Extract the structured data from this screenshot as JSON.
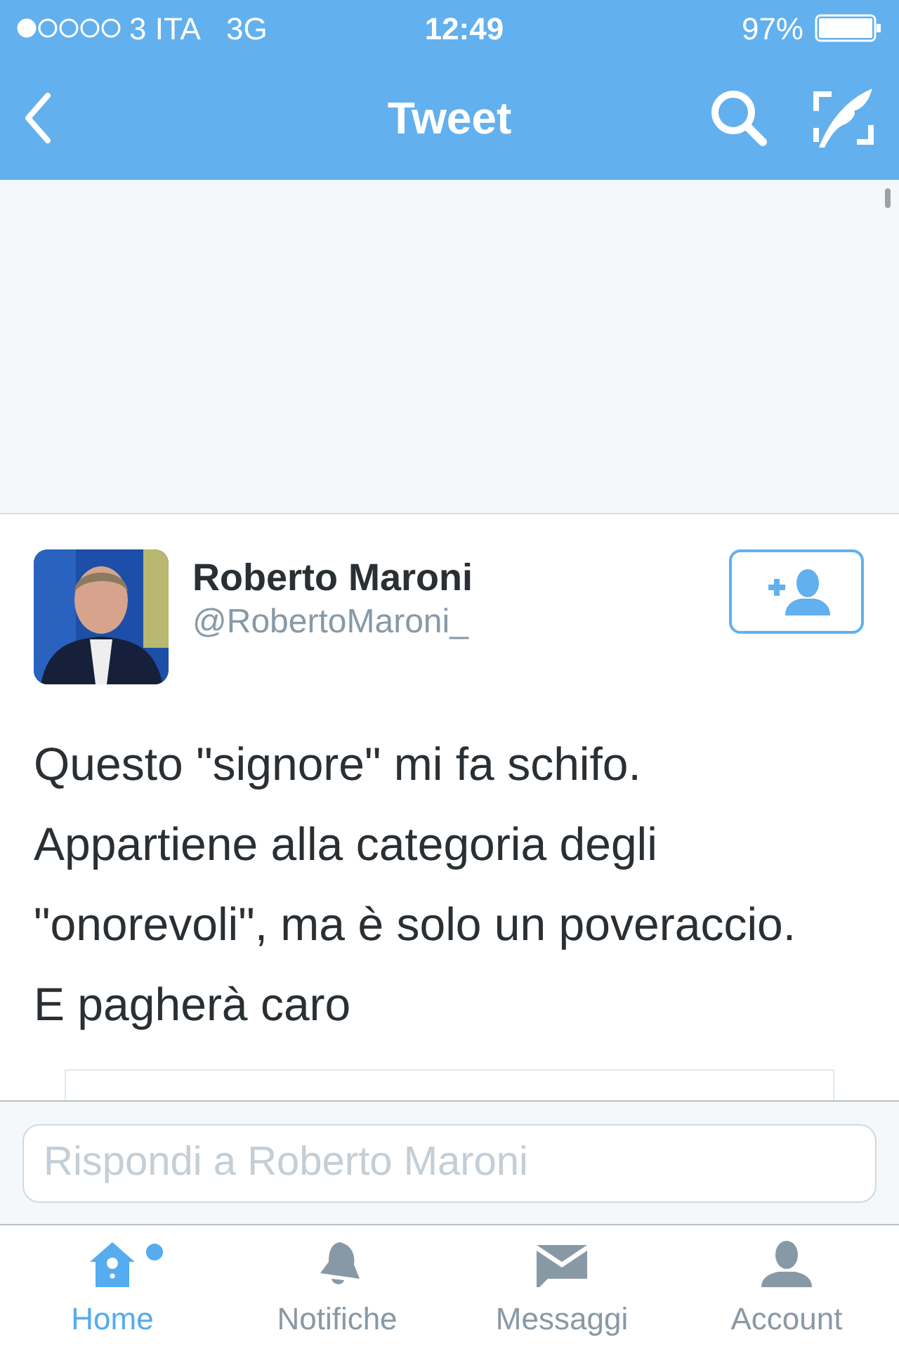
{
  "status_bar": {
    "carrier": "3 ITA",
    "network": "3G",
    "time": "12:49",
    "battery": "97%"
  },
  "nav": {
    "title": "Tweet"
  },
  "tweet": {
    "name": "Roberto Maroni",
    "handle": "@RobertoMaroni_",
    "following": false,
    "text": "Questo \"signore\" mi fa schifo. Appartiene alla categoria degli \"onorevoli\", ma è solo un poveraccio. E pagherà caro"
  },
  "reply": {
    "placeholder": "Rispondi a Roberto Maroni"
  },
  "tabs": [
    {
      "label": "Home",
      "kind": "home",
      "selected": true,
      "unread": true
    },
    {
      "label": "Notifiche",
      "kind": "bell",
      "selected": false,
      "unread": false
    },
    {
      "label": "Messaggi",
      "kind": "mail",
      "selected": false,
      "unread": false
    },
    {
      "label": "Account",
      "kind": "person",
      "selected": false,
      "unread": false
    }
  ]
}
